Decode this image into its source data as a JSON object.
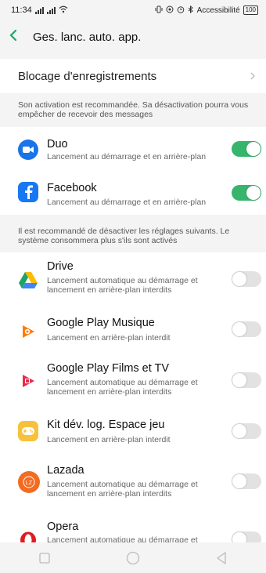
{
  "status_bar": {
    "time": "11:34",
    "right_text": "Accessibilité",
    "battery": "100"
  },
  "header": {
    "title": "Ges. lanc. auto. app."
  },
  "blocking": {
    "label": "Blocage d'enregistrements"
  },
  "section_recommended": {
    "note": "Son activation est recommandée. Sa désactivation pourra vous empêcher de recevoir des messages",
    "apps": [
      {
        "name": "Duo",
        "desc": "Lancement au démarrage et en arrière-plan",
        "enabled": true,
        "icon": "duo-icon",
        "color": "#1a73e8"
      },
      {
        "name": "Facebook",
        "desc": "Lancement au démarrage et en arrière-plan",
        "enabled": true,
        "icon": "facebook-icon",
        "color": "#1877f2"
      }
    ]
  },
  "section_disable": {
    "note": "Il est recommandé de désactiver les réglages suivants. Le système consommera plus s'ils sont activés",
    "apps": [
      {
        "name": "Drive",
        "desc": "Lancement automatique au démarrage et lancement en arrière-plan interdits",
        "enabled": false,
        "icon": "drive-icon"
      },
      {
        "name": "Google Play Musique",
        "desc": "Lancement en arrière-plan interdit",
        "enabled": false,
        "icon": "play-music-icon"
      },
      {
        "name": "Google Play Films et TV",
        "desc": "Lancement automatique au démarrage et lancement en arrière-plan interdits",
        "enabled": false,
        "icon": "play-movies-icon"
      },
      {
        "name": "Kit dév. log. Espace jeu",
        "desc": "Lancement en arrière-plan interdit",
        "enabled": false,
        "icon": "game-space-icon"
      },
      {
        "name": "Lazada",
        "desc": "Lancement automatique au démarrage et lancement en arrière-plan interdits",
        "enabled": false,
        "icon": "lazada-icon"
      },
      {
        "name": "Opera",
        "desc": "Lancement automatique au démarrage et",
        "enabled": false,
        "icon": "opera-icon"
      }
    ]
  },
  "colors": {
    "accent": "#36b56c",
    "back": "#1fa56a"
  }
}
